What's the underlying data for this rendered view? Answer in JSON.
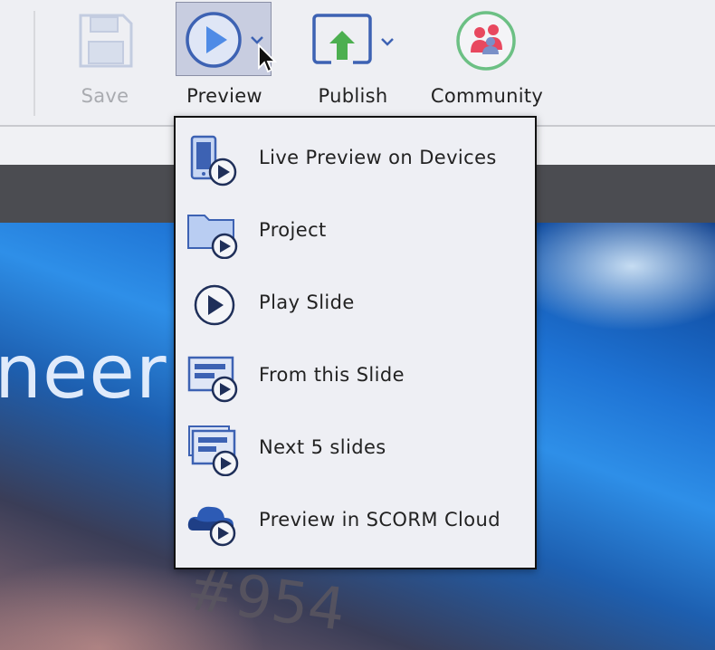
{
  "toolbar": {
    "save_label": "Save",
    "preview_label": "Preview",
    "publish_label": "Publish",
    "community_label": "Community"
  },
  "icons": {
    "save": "save-disk-icon",
    "preview": "play-circle-icon",
    "publish": "publish-upload-icon",
    "community": "community-people-icon",
    "dropdown": "chevron-down-icon"
  },
  "preview_menu": {
    "items": [
      {
        "label": "Live Preview on Devices",
        "icon": "device-preview-icon"
      },
      {
        "label": "Project",
        "icon": "folder-play-icon"
      },
      {
        "label": "Play Slide",
        "icon": "play-circle-icon"
      },
      {
        "label": "From this Slide",
        "icon": "slide-play-icon"
      },
      {
        "label": "Next 5 slides",
        "icon": "slides-stack-play-icon"
      },
      {
        "label": "Preview in SCORM Cloud",
        "icon": "cloud-play-icon"
      }
    ]
  },
  "slide": {
    "visible_text": "neeri",
    "visible_number": "#954"
  },
  "colors": {
    "accent_blue": "#3d62b3",
    "icon_fill": "#b9cdf2",
    "publish_green": "#4caf50",
    "community_ring": "#6cc084",
    "community_people": "#e8485f"
  }
}
